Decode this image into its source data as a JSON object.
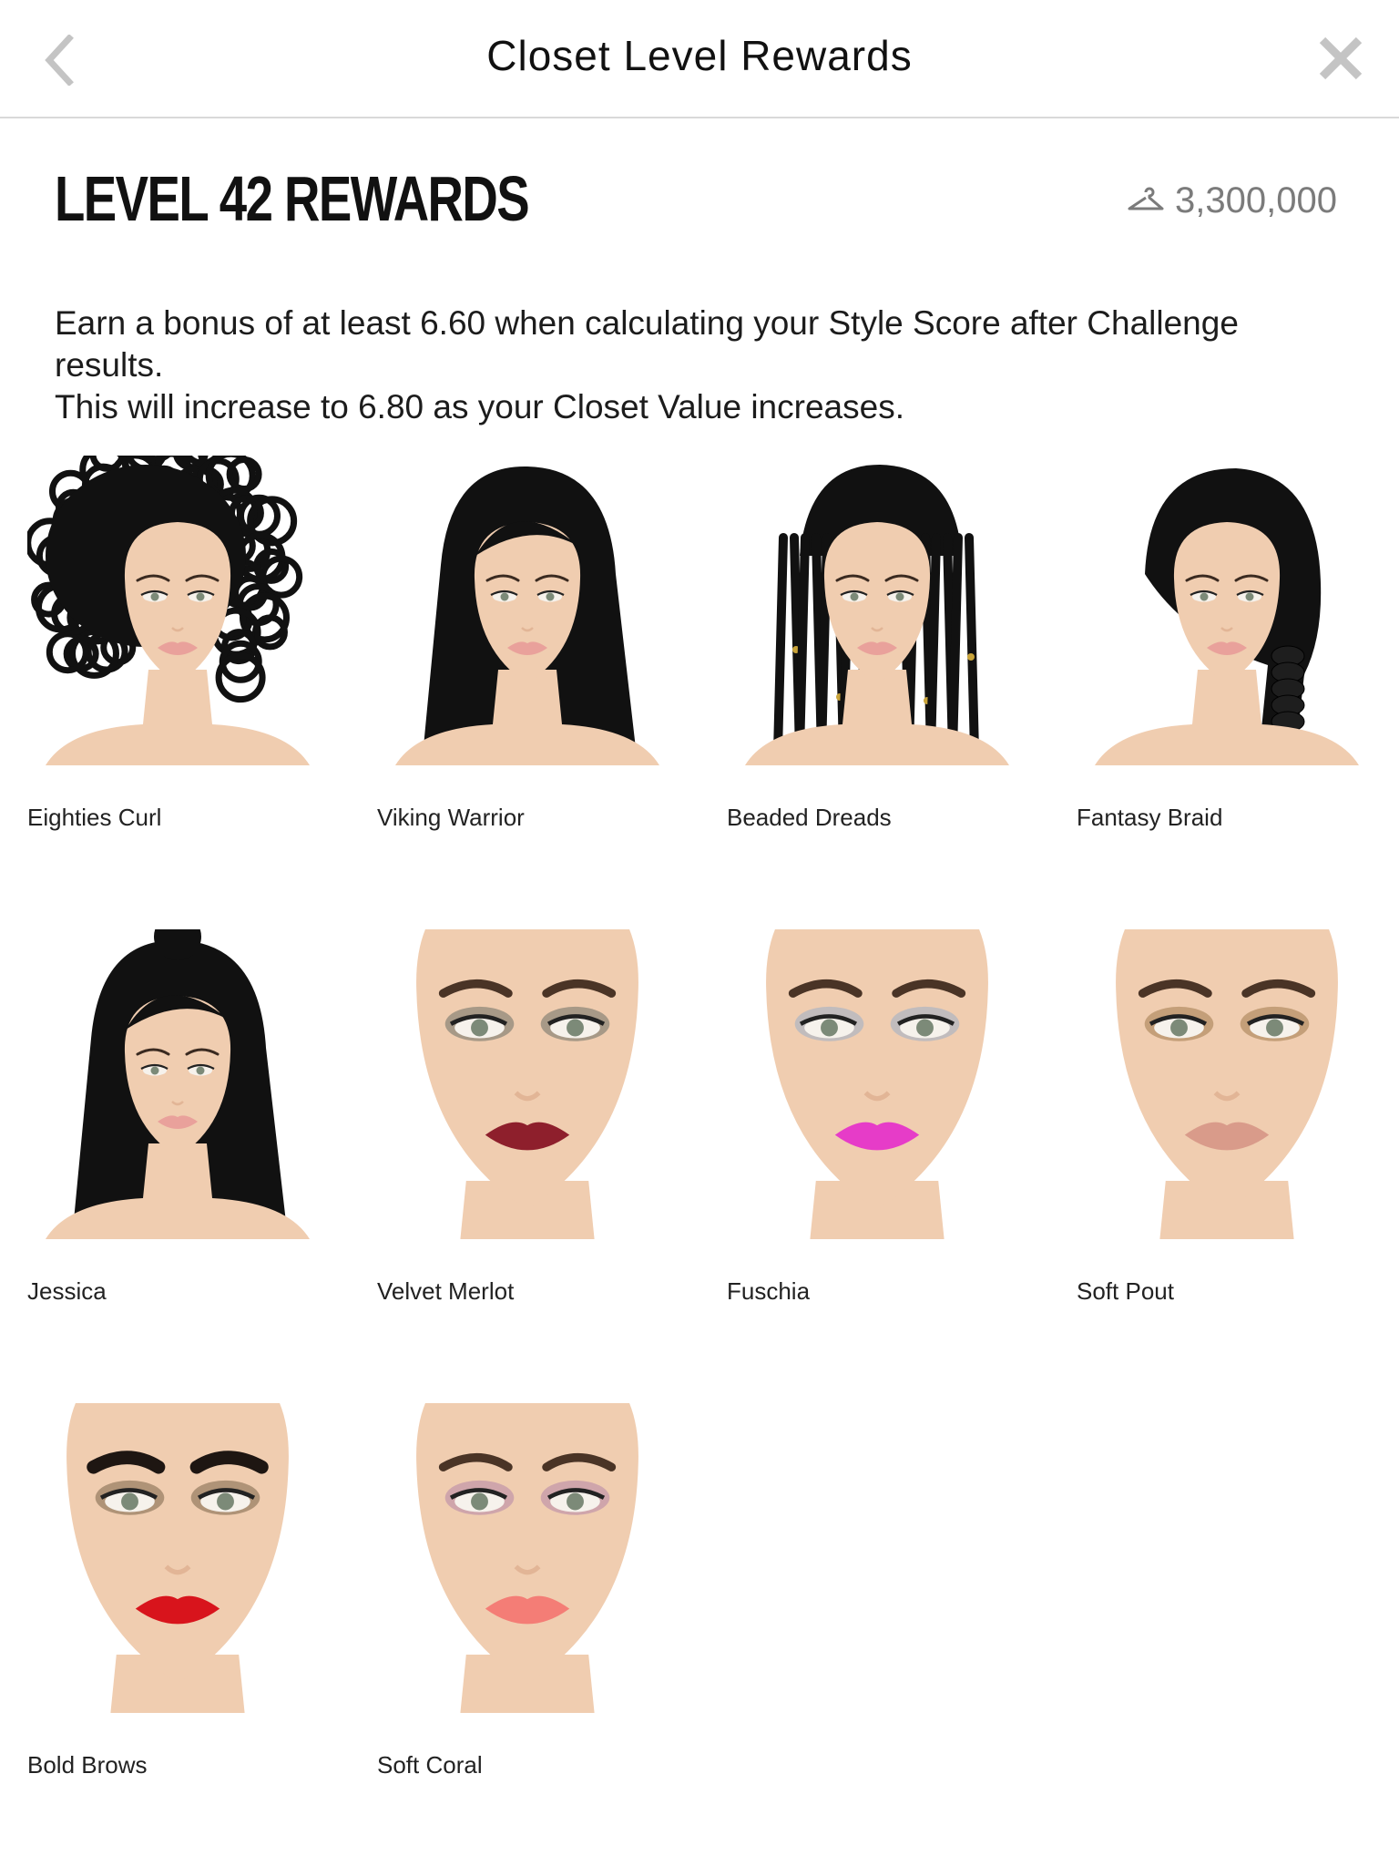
{
  "header": {
    "title": "Closet Level Rewards",
    "back_icon": "chevron-left-icon",
    "close_icon": "close-icon"
  },
  "level": {
    "title": "LEVEL 42 REWARDS",
    "closet_value": "3,300,000",
    "value_icon": "hanger-icon"
  },
  "description": {
    "line1": "Earn a bonus of at least 6.60 when calculating your Style Score after Challenge results.",
    "line2": "This will increase to 6.80 as your Closet Value increases."
  },
  "rewards": [
    {
      "label": "Eighties Curl",
      "kind": "hair",
      "style": "curl"
    },
    {
      "label": "Viking Warrior",
      "kind": "hair",
      "style": "long"
    },
    {
      "label": "Beaded Dreads",
      "kind": "hair",
      "style": "dreads"
    },
    {
      "label": "Fantasy Braid",
      "kind": "hair",
      "style": "braid"
    },
    {
      "label": "Jessica",
      "kind": "hair",
      "style": "bun"
    },
    {
      "label": "Velvet Merlot",
      "kind": "makeup",
      "lip": "#8e1f2c",
      "shadow": "#6b6f66"
    },
    {
      "label": "Fuschia",
      "kind": "makeup",
      "lip": "#e63cc8",
      "shadow": "#9aaec8"
    },
    {
      "label": "Soft Pout",
      "kind": "makeup",
      "lip": "#d99b8a",
      "shadow": "#a07a4c"
    },
    {
      "label": "Bold Brows",
      "kind": "makeup",
      "lip": "#d8141c",
      "shadow": "#7a6448"
    },
    {
      "label": "Soft Coral",
      "kind": "makeup",
      "lip": "#f47d76",
      "shadow": "#b585a8"
    }
  ],
  "colors": {
    "skin": "#f0cdb0",
    "skin_shade": "#e2b596",
    "hair": "#111111",
    "divider": "#d9d9d9",
    "muted_text": "#7b7b7b"
  }
}
